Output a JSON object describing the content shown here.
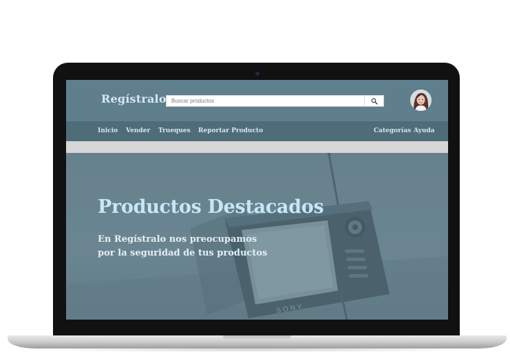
{
  "brand": {
    "name": "Regístralo"
  },
  "search": {
    "placeholder": "Buscar productos",
    "value": ""
  },
  "nav": {
    "left": [
      "Inicio",
      "Vender",
      "Trueques",
      "Reportar Producto"
    ],
    "right": [
      "Categorías",
      "Ayuda"
    ]
  },
  "hero": {
    "title": "Productos Destacados",
    "subtitle_line1": "En Regístralo nos preocupamos",
    "subtitle_line2": "por la seguridad de tus productos",
    "image_text": "SONY"
  },
  "icons": {
    "search": "search-icon",
    "avatar": "user-avatar"
  },
  "colors": {
    "header": "#5f7f8d",
    "navbar": "#4f6c79",
    "accent_text": "#c7e6f6"
  }
}
